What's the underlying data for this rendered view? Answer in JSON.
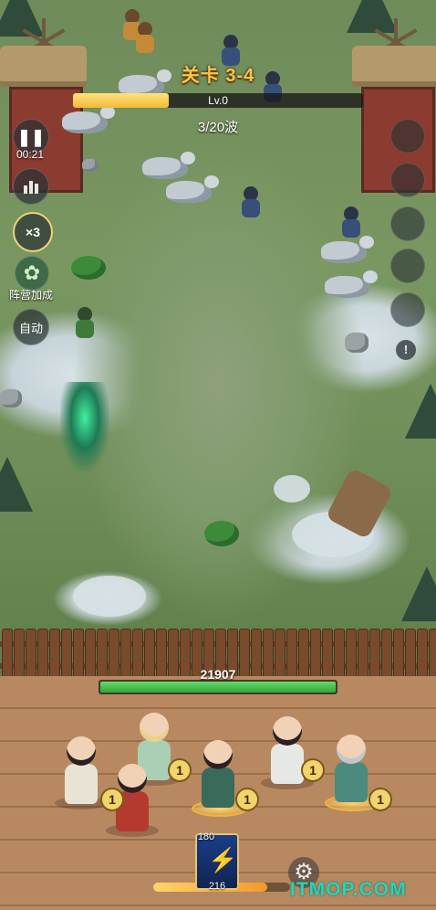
{
  "hud": {
    "level_title": "关卡 3-4",
    "level_label": "Lv.0",
    "level_progress": 0.33,
    "wave": "3/20波",
    "timer": "00:21"
  },
  "controls": {
    "speed_label": "×3",
    "faction_label": "阵营加成",
    "auto_label": "自动",
    "alert_label": "!"
  },
  "base": {
    "hp_value": "21907",
    "hp_fraction": 1.0
  },
  "heroes": {
    "badges": [
      "1",
      "1",
      "1",
      "1",
      "1"
    ]
  },
  "skill_card": {
    "top_value": "180",
    "bottom_value": "216",
    "energy_fraction": 0.83
  },
  "icons": [
    "pause-icon",
    "bar-chart-icon",
    "faction-icon",
    "gear-icon",
    "lightning-icon",
    "alert-icon"
  ],
  "colors": {
    "title_gold": "#f5c64a",
    "hp_green": "#2fa83a",
    "xp_yellow": "#f2b93a"
  },
  "watermark": "ITMOP.COM"
}
